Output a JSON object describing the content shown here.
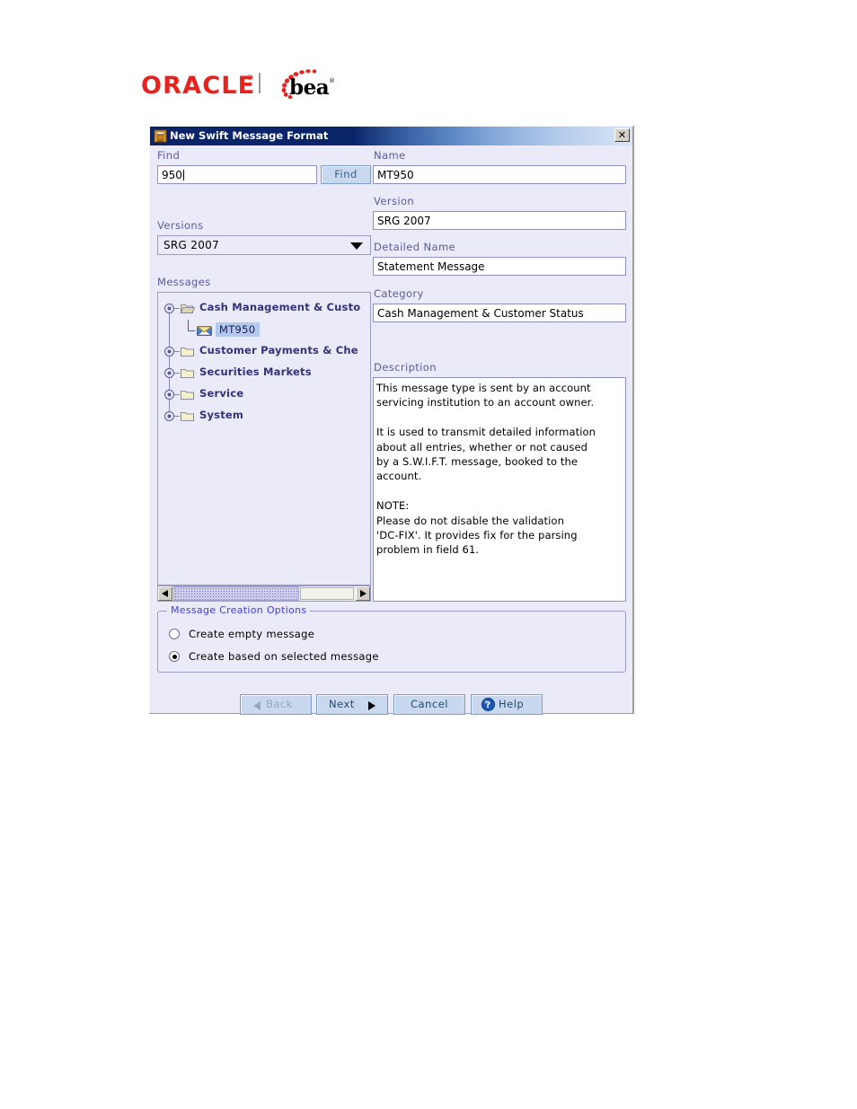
{
  "logo": {
    "oracle_text": "ORACLE",
    "oracle_registered": "®",
    "bea_text": "bea",
    "bea_registered": "®"
  },
  "dialog": {
    "title": "New Swift Message Format",
    "title_icon": "coffee-cup-icon",
    "close_label": "✕"
  },
  "left": {
    "find_label": "Find",
    "find_value": "950",
    "find_button": "Find",
    "versions_label": "Versions",
    "versions_value": "SRG 2007",
    "messages_label": "Messages",
    "tree": [
      {
        "label": "Cash Management & Custo",
        "expanded": true,
        "icon": "open-folder-icon"
      },
      {
        "label": "Customer Payments & Che",
        "expanded": false,
        "icon": "folder-icon"
      },
      {
        "label": "Securities Markets",
        "expanded": false,
        "icon": "folder-icon"
      },
      {
        "label": "Service",
        "expanded": false,
        "icon": "folder-icon"
      },
      {
        "label": "System",
        "expanded": false,
        "icon": "folder-icon"
      }
    ],
    "tree_child": {
      "label": "MT950",
      "icon": "mail-message-icon",
      "selected": true
    }
  },
  "right": {
    "name_label": "Name",
    "name_value": "MT950",
    "version_label": "Version",
    "version_value": "SRG 2007",
    "detailed_name_label": "Detailed Name",
    "detailed_name_value": "Statement Message",
    "category_label": "Category",
    "category_value": "Cash Management & Customer Status",
    "description_label": "Description",
    "description_value": "This message type is sent by an account\nservicing institution to an account owner.\n\nIt is used to transmit detailed information\nabout all entries, whether or not caused\nby a S.W.I.F.T. message, booked to the\naccount.\n\nNOTE:\nPlease do not disable the validation\n'DC-FIX'. It provides fix for the parsing\nproblem in field 61."
  },
  "options": {
    "legend": "Message Creation Options",
    "items": [
      {
        "label": "Create empty message",
        "selected": false
      },
      {
        "label": "Create based on selected message",
        "selected": true
      }
    ]
  },
  "buttons": {
    "back": "Back",
    "next": "Next",
    "cancel": "Cancel",
    "help": "Help"
  },
  "colors": {
    "dialog_bg": "#eaeaf9",
    "title_bar_start": "#0a246a",
    "title_bar_end": "#d8e6f7",
    "label_text": "#5b5b9e",
    "tree_text": "#333377",
    "selection": "#b2caee",
    "button_face": "#c8d8ee",
    "oracle_red": "#e8221f",
    "legend_blue": "#3d3df0"
  }
}
